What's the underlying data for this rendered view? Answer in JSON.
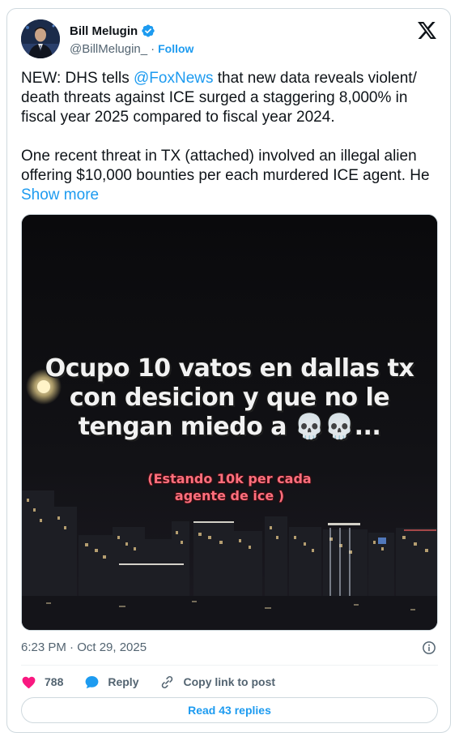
{
  "author": {
    "name": "Bill Melugin",
    "handle": "@BillMelugin_",
    "separator": "·",
    "follow_label": "Follow",
    "verified_color": "#1d9bf0"
  },
  "icons": {
    "logo": "x-logo-icon",
    "verified": "verified-badge-icon",
    "info": "info-icon",
    "like": "heart-icon",
    "reply": "reply-bubble-icon",
    "copy": "link-icon"
  },
  "tweet": {
    "text_part1_before": "NEW: DHS tells ",
    "mention": "@FoxNews",
    "text_part1_after": " that new data reveals violent/ death threats against ICE surged a staggering 8,000% in fiscal year 2025 compared to fiscal year 2024.",
    "text_part2": "One recent threat in TX (attached) involved an illegal alien offering $10,000 bounties per each murdered ICE agent. He ",
    "show_more": "Show more"
  },
  "media": {
    "overlay_line1": "Ocupo 10 vatos en dallas tx",
    "overlay_line2": "con desicion y que no le",
    "overlay_line3": "tengan miedo a 💀💀...",
    "overlay_red_line1": "(Estando 10k per cada",
    "overlay_red_line2": "agente de ice )"
  },
  "meta": {
    "timestamp": "6:23 PM · Oct 29, 2025"
  },
  "actions": {
    "like_count": "788",
    "reply_label": "Reply",
    "copy_label": "Copy link to post",
    "read_replies": "Read 43 replies"
  },
  "colors": {
    "accent": "#1d9bf0",
    "like": "#f91880",
    "text": "#0f1419",
    "secondary": "#536471",
    "border": "#cfd9de"
  }
}
